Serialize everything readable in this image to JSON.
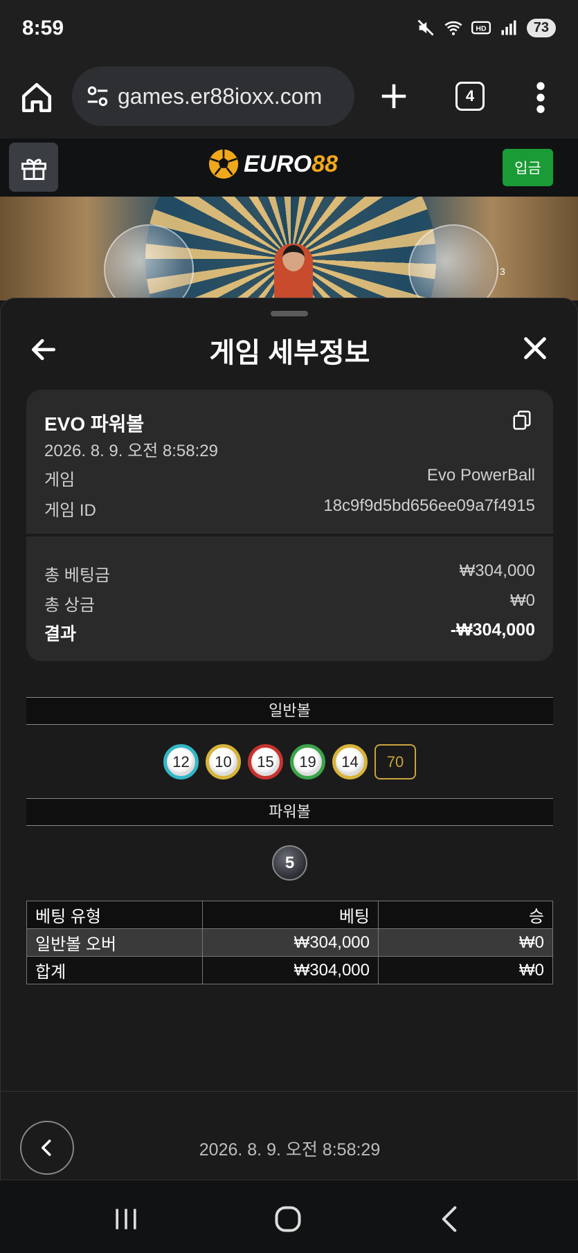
{
  "status": {
    "time": "8:59",
    "battery": "73"
  },
  "browser": {
    "url": "games.er88ioxx.com",
    "tab_count": "4"
  },
  "site": {
    "logo_part1": "EURO",
    "logo_part2": "88",
    "deposit_label": "입금"
  },
  "video": {
    "corner_label": "3"
  },
  "sheet": {
    "title": "게임 세부정보",
    "card": {
      "title": "EVO 파워볼",
      "date": "2026. 8. 9. 오전 8:58:29",
      "game_label": "게임",
      "game_value": "Evo PowerBall",
      "id_label": "게임 ID",
      "id_value": "18c9f9d5bd656ee09a7f4915",
      "total_bet_label": "총 베팅금",
      "total_bet_value": "₩304,000",
      "total_win_label": "총 상금",
      "total_win_value": "₩0",
      "result_label": "결과",
      "result_value": "-₩304,000"
    },
    "normal_section": "일반볼",
    "normal_balls": [
      "12",
      "10",
      "15",
      "19",
      "14"
    ],
    "normal_sum": "70",
    "power_section": "파워볼",
    "power_ball": "5",
    "table": {
      "headers": [
        "베팅 유형",
        "베팅",
        "승"
      ],
      "rows": [
        [
          "일반볼 오버",
          "₩304,000",
          "₩0"
        ],
        [
          "합계",
          "₩304,000",
          "₩0"
        ]
      ]
    },
    "footer_date": "2026. 8. 9. 오전 8:58:29"
  },
  "colors": {
    "accent_gold": "#f0a81b",
    "deposit_green": "#1a9b35"
  }
}
